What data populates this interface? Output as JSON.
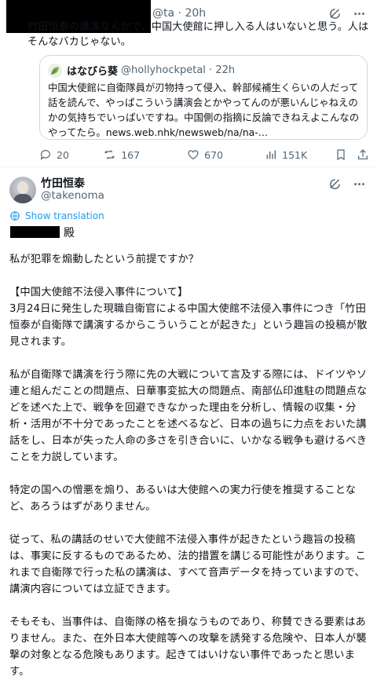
{
  "top_tweet": {
    "header_handle": "@ta",
    "time": "20h",
    "text": "竹田恒泰の講演なんかで、中国大使館に押し入る人はいないと思う。人はそんなバカじゃない。",
    "quote": {
      "name": "はなびら葵",
      "handle": "@hollyhockpetal",
      "time": "22h",
      "text": "中国大使館に自衛隊員が刃物持って侵入、幹部候補生くらいの人だって話を読んで、やっぱこういう講演会とかやってんのが悪いんじゃねえのかの気持ちでいっぱいですね。中国側の指摘に反論できねえよこんなのやってたら。news.web.nhk/newsweb/na/na-…"
    },
    "metrics": {
      "replies": "20",
      "reposts": "167",
      "likes": "670",
      "views": "151K"
    }
  },
  "main_tweet": {
    "name": "竹田恒泰",
    "handle": "@takenoma",
    "translate_label": "Show translation",
    "salutation_suffix": "殿",
    "paragraphs": [
      "私が犯罪を煽動したという前提ですか？",
      "【中国大使館不法侵入事件について】\n3月24日に発生した現職自衛官による中国大使館不法侵入事件につき「竹田恒泰が自衛隊で講演するからこういうことが起きた」という趣旨の投稿が散見されます。",
      "私が自衛隊で講演を行う際に先の大戦について言及する際には、ドイツやソ連と組んだことの問題点、日華事変拡大の問題点、南部仏印進駐の問題点などを述べた上で、戦争を回避できなかった理由を分析し、情報の収集・分析・活用が不十分であったことを述べるなど、日本の過ちに力点をおいた講話をし、日本が失った人命の多さを引き合いに、いかなる戦争も避けるべきことを力説しています。",
      "特定の国への憎悪を煽り、あるいは大使館への実力行使を推奨することなど、あろうはずがありません。",
      "従って、私の講話のせいで大使館不法侵入事件が起きたという趣旨の投稿は、事実に反するものであるため、法的措置を講じる可能性があります。これまで自衛隊で行った私の講演は、すべて音声データを持っていますので、講演内容については立証できます。",
      "そもそも、当事件は、自衛隊の格を損なうものであり、称賛できる要素はありません。また、在外日本大使館等への攻撃を誘発する危険や、日本人が襲撃の対象となる危険もあります。起きてはいけない事件であったと思います。"
    ]
  },
  "colors": {
    "link": "#1d9bf0",
    "secondary_text": "#536471",
    "border": "#cfd9de"
  }
}
